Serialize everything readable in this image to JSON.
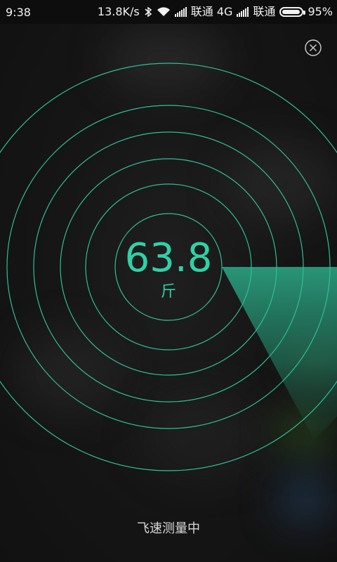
{
  "status_bar": {
    "time": "9:38",
    "network_speed": "13.8K/s",
    "carrier1": "联通 4G",
    "carrier2": "联通",
    "battery_percent": "95%",
    "battery_level": 0.95,
    "icons": [
      "bluetooth-icon",
      "wifi-icon",
      "signal-icon",
      "battery-icon"
    ]
  },
  "close_button": {
    "icon": "close-icon"
  },
  "measurement": {
    "value": "63.8",
    "unit": "斤"
  },
  "status_text": "飞速测量中",
  "colors": {
    "accent": "#2fd1a8",
    "ring": "#2fbf95",
    "sweep": "#2a9c7c",
    "background": "#141414"
  }
}
